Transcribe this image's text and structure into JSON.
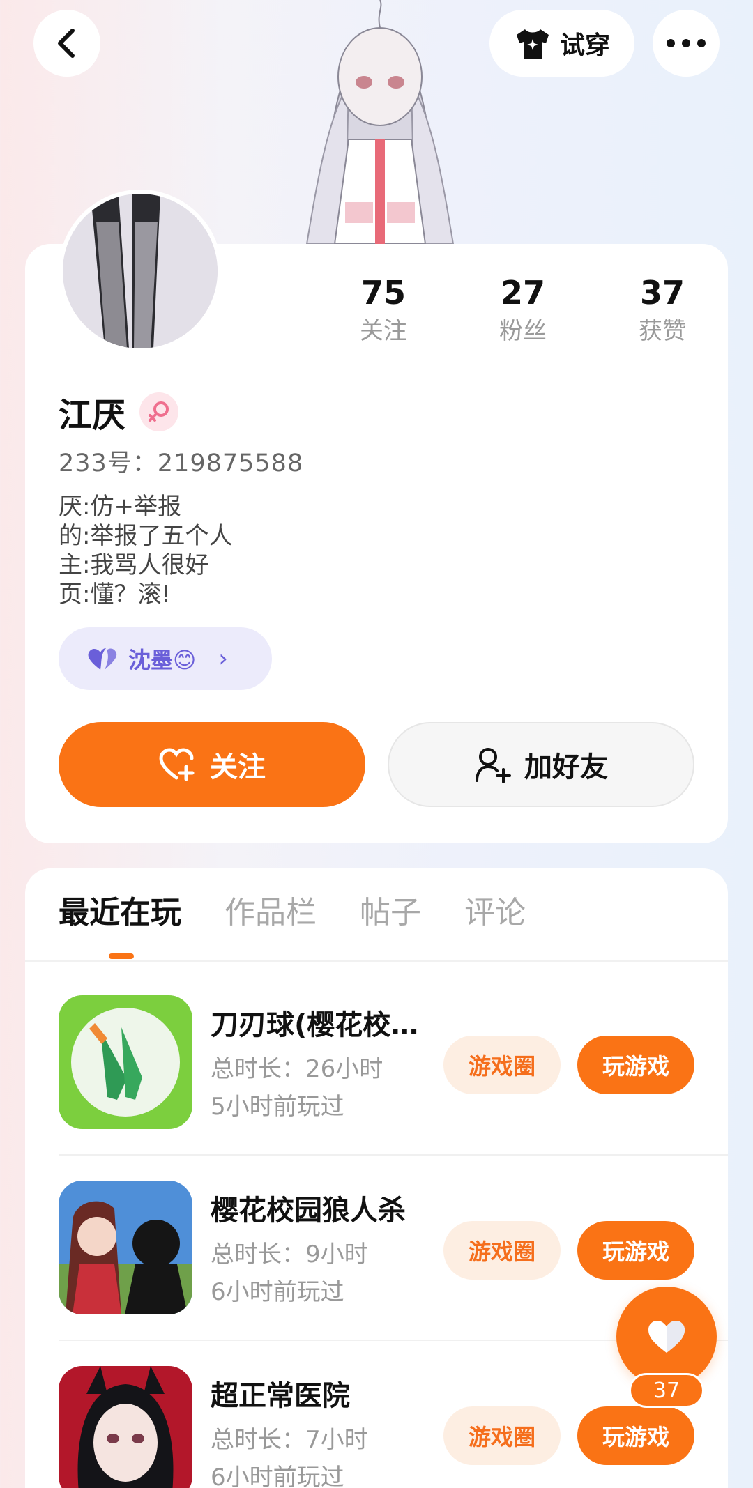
{
  "topbar": {
    "back_icon": "chevron-left-icon",
    "tryon_label": "试穿",
    "more_icon": "more-horizontal-icon"
  },
  "profile": {
    "stats": [
      {
        "value": "75",
        "label": "关注"
      },
      {
        "value": "27",
        "label": "粉丝"
      },
      {
        "value": "37",
        "label": "获赞"
      }
    ],
    "name": "江厌",
    "gender_icon": "female-icon",
    "uid": "233号：219875588",
    "bio": [
      "厌:仿+举报",
      "的:举报了五个人",
      "主:我骂人很好",
      "页:懂？滚!"
    ],
    "relation_label": "沈墨😊",
    "follow_label": "关注",
    "add_friend_label": "加好友"
  },
  "tabs": [
    "最近在玩",
    "作品栏",
    "帖子",
    "评论"
  ],
  "games": [
    {
      "title": "刀刃球(樱花校…",
      "duration": "总时长：26小时",
      "last_played": "5小时前玩过",
      "circle_label": "游戏圈",
      "play_label": "玩游戏"
    },
    {
      "title": "樱花校园狼人杀",
      "duration": "总时长：9小时",
      "last_played": "6小时前玩过",
      "circle_label": "游戏圈",
      "play_label": "玩游戏"
    },
    {
      "title": "超正常医院",
      "duration": "总时长：7小时",
      "last_played": "6小时前玩过",
      "circle_label": "游戏圈",
      "play_label": "玩游戏"
    }
  ],
  "floating_like": {
    "count": "37"
  },
  "colors": {
    "accent": "#fa7315",
    "accent_soft": "#fdeee2",
    "relation": "#6a5fd9"
  }
}
